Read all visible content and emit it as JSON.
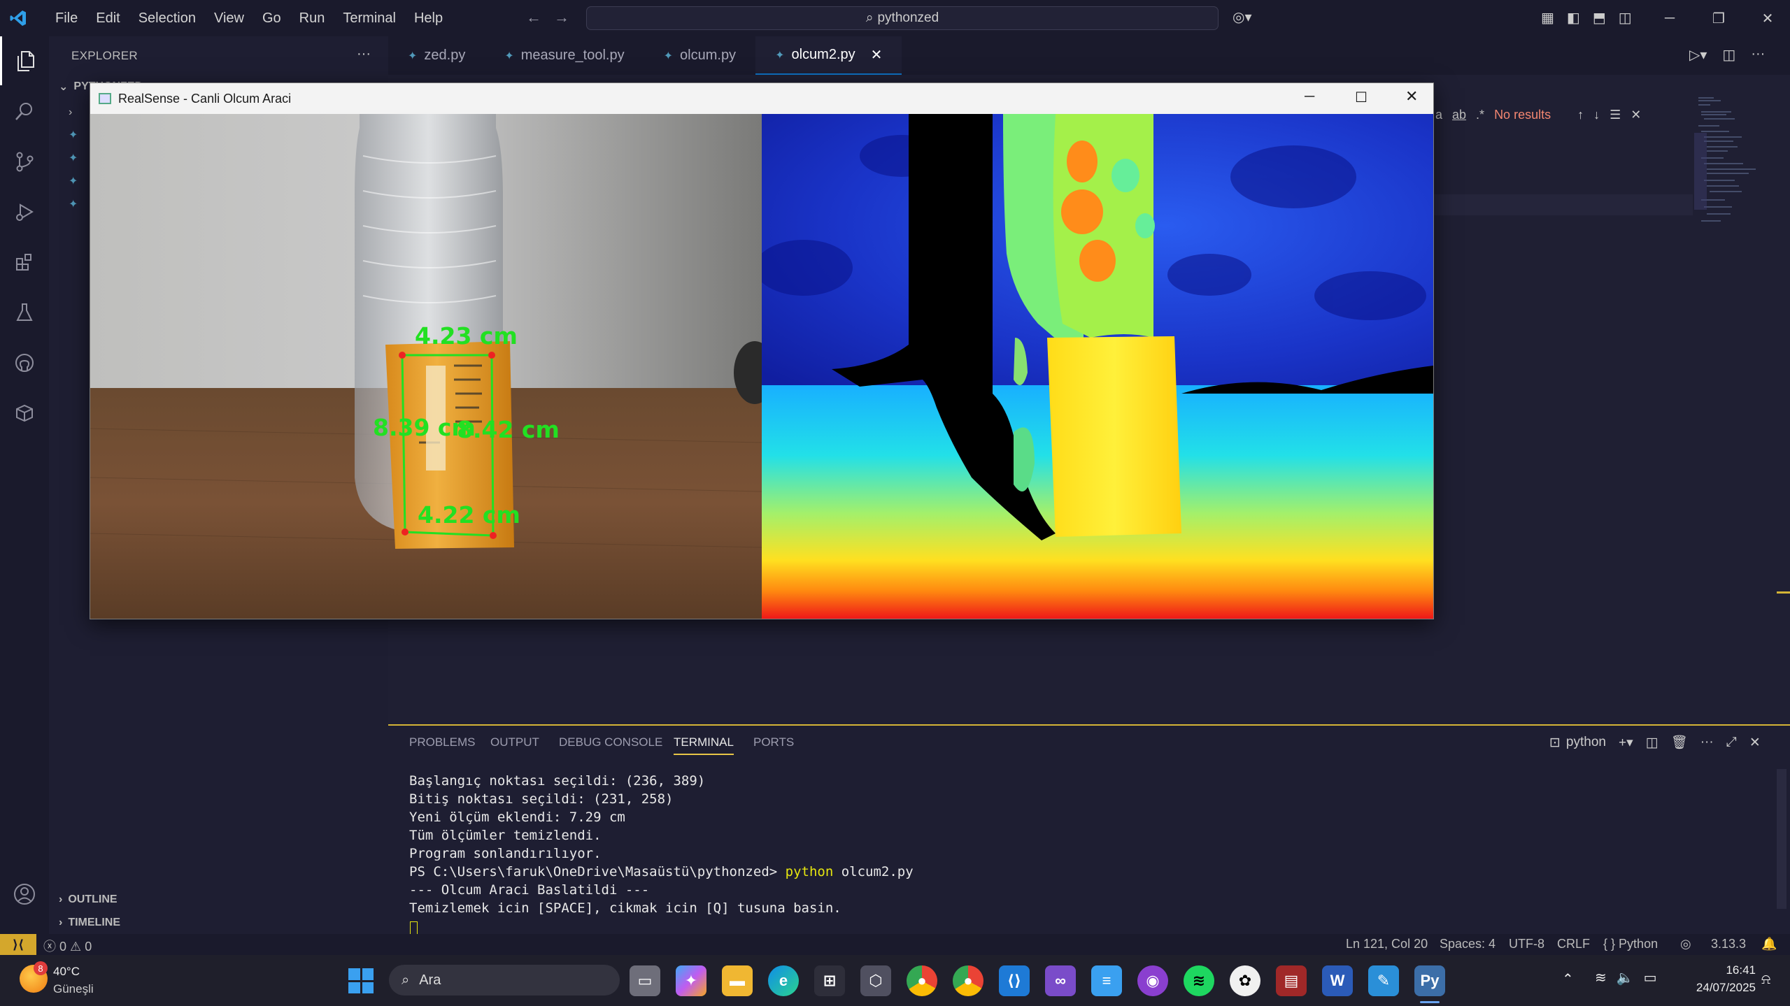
{
  "titlebar": {
    "menu": [
      "File",
      "Edit",
      "Selection",
      "View",
      "Go",
      "Run",
      "Terminal",
      "Help"
    ],
    "search_text": "pythonzed"
  },
  "sidebar": {
    "title": "EXPLORER",
    "folder": "PYTHONZED",
    "outline": "OUTLINE",
    "timeline": "TIMELINE"
  },
  "tabs": [
    {
      "label": "zed.py",
      "active": false
    },
    {
      "label": "measure_tool.py",
      "active": false
    },
    {
      "label": "olcum.py",
      "active": false
    },
    {
      "label": "olcum2.py",
      "active": true
    }
  ],
  "find": {
    "no_results": "No results"
  },
  "realsense": {
    "title": "RealSense - Canli Olcum Araci",
    "labels": {
      "top": "4.23 cm",
      "left": "8.39 cm",
      "right": "8.42 cm",
      "bottom": "4.22 cm"
    }
  },
  "panel": {
    "tabs": [
      "PROBLEMS",
      "OUTPUT",
      "DEBUG CONSOLE",
      "TERMINAL",
      "PORTS"
    ],
    "active_tab": "TERMINAL",
    "shell": "python",
    "lines": [
      "Başlangıç noktası seçildi: (236, 389)",
      "Bitiş noktası seçildi: (231, 258)",
      "Yeni ölçüm eklendi: 7.29 cm",
      "Tüm ölçümler temizlendi.",
      "Program sonlandırılıyor."
    ],
    "prompt": "PS C:\\Users\\faruk\\OneDrive\\Masaüstü\\pythonzed> ",
    "command_exe": "python",
    "command_arg": " olcum2.py",
    "out1": "--- Olcum Araci Baslatildi ---",
    "out2": "Temizlemek icin [SPACE], cikmak icin [Q] tusuna basin."
  },
  "status": {
    "errors": "0",
    "warnings": "0",
    "position": "Ln 121, Col 20",
    "spaces": "Spaces: 4",
    "encoding": "UTF-8",
    "eol": "CRLF",
    "language": "Python",
    "version": "3.13.3"
  },
  "taskbar": {
    "weather_temp": "40°C",
    "weather_desc": "Güneşli",
    "weather_badge": "8",
    "search_placeholder": "Ara",
    "time": "16:41",
    "date": "24/07/2025"
  }
}
